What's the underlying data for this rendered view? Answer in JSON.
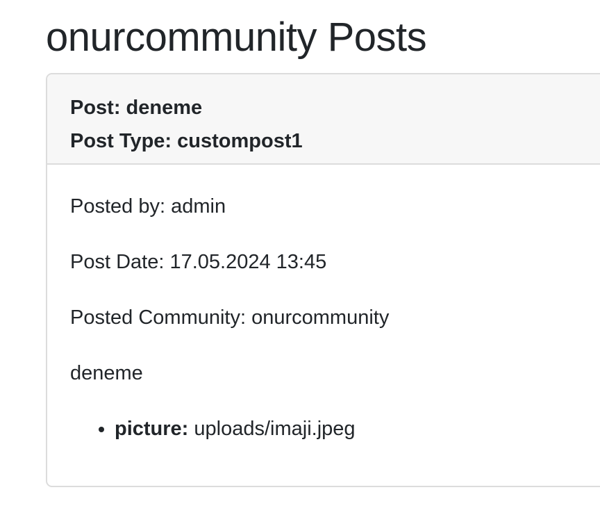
{
  "page": {
    "title": "onurcommunity Posts"
  },
  "post": {
    "header": {
      "post_label": "Post: deneme",
      "type_label": "Post Type: custompost1"
    },
    "posted_by": "Posted by: admin",
    "post_date": "Post Date: 17.05.2024 13:45",
    "posted_community": "Posted Community: onurcommunity",
    "content": "deneme",
    "fields": [
      {
        "key": "picture:",
        "value": "uploads/imaji.jpeg"
      }
    ]
  }
}
